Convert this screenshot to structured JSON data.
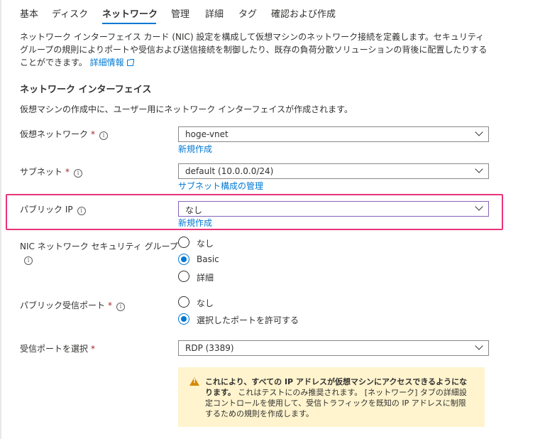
{
  "tabs": [
    {
      "label": "基本",
      "active": false
    },
    {
      "label": "ディスク",
      "active": false
    },
    {
      "label": "ネットワーク",
      "active": true
    },
    {
      "label": "管理",
      "active": false
    },
    {
      "label": "詳細",
      "active": false
    },
    {
      "label": "タグ",
      "active": false
    },
    {
      "label": "確認および作成",
      "active": false
    }
  ],
  "intro": {
    "text": "ネットワーク インターフェイス カード (NIC) 設定を構成して仮想マシンのネットワーク接続を定義します。セキュリティ グループの規則によりポートや受信および送信接続を制御したり、既存の負荷分散ソリューションの背後に配置したりすることができます。",
    "learn_more": "詳細情報"
  },
  "section": {
    "title": "ネットワーク インターフェイス",
    "description": "仮想マシンの作成中に、ユーザー用にネットワーク インターフェイスが作成されます。"
  },
  "fields": {
    "vnet": {
      "label": "仮想ネットワーク",
      "required_mark": "*",
      "value": "hoge-vnet",
      "link": "新規作成"
    },
    "subnet": {
      "label": "サブネット",
      "required_mark": "*",
      "value": "default (10.0.0.0/24)",
      "link": "サブネット構成の管理"
    },
    "public_ip": {
      "label": "パブリック IP",
      "value": "なし",
      "link": "新規作成"
    },
    "nsg": {
      "label": "NIC ネットワーク セキュリティ グループ",
      "options": [
        "なし",
        "Basic",
        "詳細"
      ],
      "selected": "Basic"
    },
    "inbound_ports": {
      "label": "パブリック受信ポート",
      "required_mark": "*",
      "options": [
        "なし",
        "選択したポートを許可する"
      ],
      "selected": "選択したポートを許可する"
    },
    "select_ports": {
      "label": "受信ポートを選択",
      "required_mark": "*",
      "value": "RDP (3389)"
    }
  },
  "warning": {
    "bold_text": "これにより、すべての IP アドレスが仮想マシンにアクセスできるようになります。",
    "text": " これはテストにのみ推奨されます。 [ネットワーク] タブの詳細設定コントロールを使用して、受信トラフィックを既知の IP アドレスに制限するための規則を作成します。"
  },
  "icons": {
    "info": "info-icon",
    "external": "external-link-icon",
    "warning": "warning-icon",
    "chevron": "chevron-down-icon"
  },
  "colors": {
    "accent": "#0078d4",
    "highlight_border": "#e8347a",
    "required": "#a4262c",
    "warning_bg": "#fff4ce"
  }
}
